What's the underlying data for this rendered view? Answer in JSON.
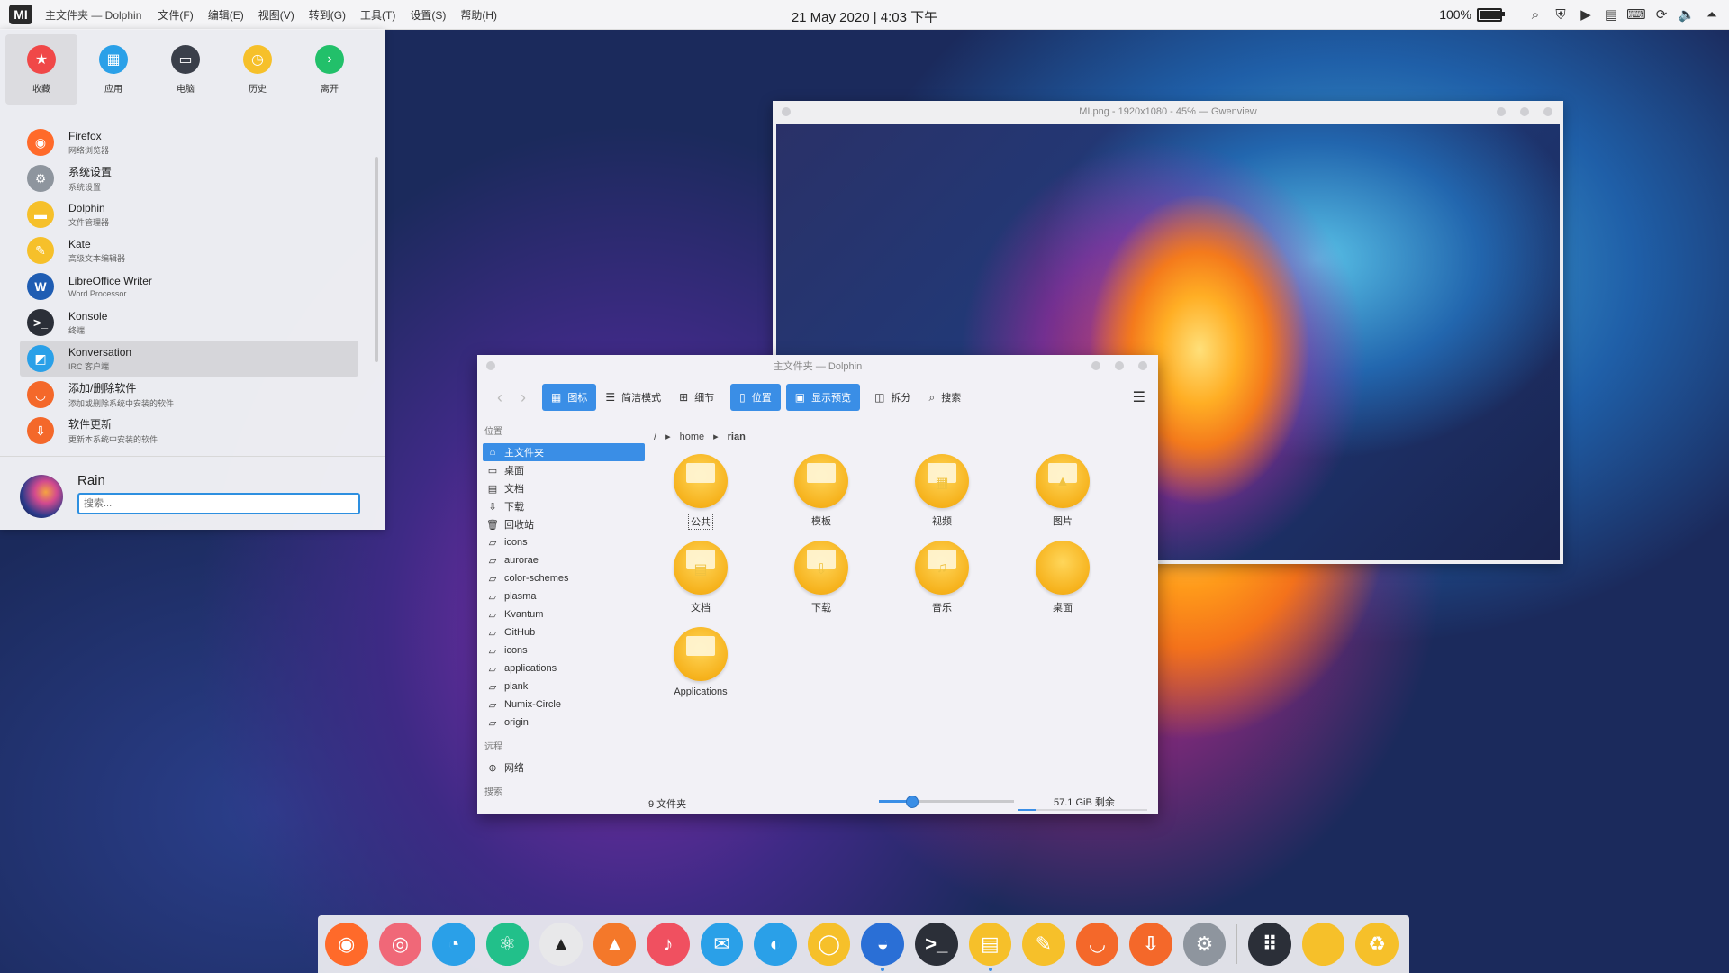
{
  "topbar": {
    "logo": "MI",
    "app_title": "主文件夹 — Dolphin",
    "menus": [
      "文件(F)",
      "编辑(E)",
      "视图(V)",
      "转到(G)",
      "工具(T)",
      "设置(S)",
      "帮助(H)"
    ],
    "clock": "21 May 2020 | 4:03 下午",
    "battery_percent": "100%",
    "battery_level": 1.0,
    "tray_icons": [
      "search-icon",
      "shield-icon",
      "play-icon",
      "clipboard-icon",
      "keyboard-icon",
      "sync-icon",
      "volume-icon",
      "up-arrow-icon"
    ]
  },
  "launcher": {
    "tabs": [
      {
        "label": "收藏",
        "icon": "star-icon",
        "color": "#f04848",
        "active": true
      },
      {
        "label": "应用",
        "icon": "grid-icon",
        "color": "#2aa0e8",
        "active": false
      },
      {
        "label": "电脑",
        "icon": "monitor-icon",
        "color": "#3a3f4a",
        "active": false
      },
      {
        "label": "历史",
        "icon": "clock-icon",
        "color": "#f6c02a",
        "active": false
      },
      {
        "label": "离开",
        "icon": "arrow-right-icon",
        "color": "#22c06a",
        "active": false
      }
    ],
    "apps": [
      {
        "name": "Firefox",
        "desc": "网络浏览器",
        "icon": "firefox-icon",
        "color": "#ff6a2a"
      },
      {
        "name": "系统设置",
        "desc": "系统设置",
        "icon": "settings-icon",
        "color": "#8e959e"
      },
      {
        "name": "Dolphin",
        "desc": "文件管理器",
        "icon": "folder-icon",
        "color": "#f6c02a"
      },
      {
        "name": "Kate",
        "desc": "高级文本编辑器",
        "icon": "pen-icon",
        "color": "#f6c02a"
      },
      {
        "name": "LibreOffice Writer",
        "desc": "Word Processor",
        "icon": "writer-icon",
        "color": "#1f5db3"
      },
      {
        "name": "Konsole",
        "desc": "终端",
        "icon": "terminal-icon",
        "color": "#2b2f38"
      },
      {
        "name": "Konversation",
        "desc": "IRC 客户端",
        "icon": "chat-icon",
        "color": "#2aa0e8"
      },
      {
        "name": "添加/删除软件",
        "desc": "添加或删除系统中安装的软件",
        "icon": "shop-icon",
        "color": "#f4682a"
      },
      {
        "name": "软件更新",
        "desc": "更新本系统中安装的软件",
        "icon": "update-icon",
        "color": "#f4682a"
      }
    ],
    "hover_index": 6,
    "user_name": "Rain",
    "search_placeholder": "搜索..."
  },
  "gwenview": {
    "title": "MI.png - 1920x1080 - 45% — Gwenview"
  },
  "dolphin": {
    "title": "主文件夹 — Dolphin",
    "toolbar": {
      "icons_label": "图标",
      "compact_label": "简洁模式",
      "details_label": "细节",
      "places_label": "位置",
      "preview_label": "显示预览",
      "split_label": "拆分",
      "search_label": "搜索"
    },
    "places_header": "位置",
    "places": [
      {
        "label": "主文件夹",
        "glyph": "⌂",
        "selected": true
      },
      {
        "label": "桌面",
        "glyph": "▭"
      },
      {
        "label": "文档",
        "glyph": "▤"
      },
      {
        "label": "下载",
        "glyph": "⇩"
      },
      {
        "label": "回收站",
        "glyph": "🗑"
      },
      {
        "label": "icons",
        "glyph": "▱"
      },
      {
        "label": "aurorae",
        "glyph": "▱"
      },
      {
        "label": "color-schemes",
        "glyph": "▱"
      },
      {
        "label": "plasma",
        "glyph": "▱"
      },
      {
        "label": "Kvantum",
        "glyph": "▱"
      },
      {
        "label": "GitHub",
        "glyph": "▱"
      },
      {
        "label": "icons",
        "glyph": "▱"
      },
      {
        "label": "applications",
        "glyph": "▱"
      },
      {
        "label": "plank",
        "glyph": "▱"
      },
      {
        "label": "Numix-Circle",
        "glyph": "▱"
      },
      {
        "label": "origin",
        "glyph": "▱"
      }
    ],
    "remote_header": "远程",
    "remote": [
      {
        "label": "网络",
        "glyph": "⊕"
      }
    ],
    "search_header": "搜索",
    "breadcrumb": {
      "root": "/",
      "home": "home",
      "user": "rian"
    },
    "files": [
      {
        "name": "公共",
        "glyph": "",
        "selected": true
      },
      {
        "name": "模板",
        "glyph": ""
      },
      {
        "name": "视频",
        "glyph": "▦"
      },
      {
        "name": "图片",
        "glyph": "▲"
      },
      {
        "name": "文档",
        "glyph": "▤"
      },
      {
        "name": "下载",
        "glyph": "⇩"
      },
      {
        "name": "音乐",
        "glyph": "♫"
      },
      {
        "name": "桌面",
        "glyph": "",
        "plain": true
      },
      {
        "name": "Applications",
        "glyph": ""
      }
    ],
    "status_count": "9 文件夹",
    "zoom_level": 0.24,
    "free_space": "57.1 GiB 剩余",
    "free_fraction": 0.14
  },
  "dock": {
    "apps": [
      {
        "name": "firefox-icon",
        "color": "#ff6a2a",
        "glyph": "◉"
      },
      {
        "name": "browser-icon",
        "color": "#f06878",
        "glyph": "◎"
      },
      {
        "name": "github-icon",
        "color": "#2aa0e8",
        "glyph": "◔"
      },
      {
        "name": "atom-icon",
        "color": "#22c08a",
        "glyph": "⚛"
      },
      {
        "name": "inkscape-icon",
        "color": "#e8e8ea",
        "glyph": "▲"
      },
      {
        "name": "vlc-icon",
        "color": "#f4782a",
        "glyph": "▲"
      },
      {
        "name": "music-icon",
        "color": "#f05060",
        "glyph": "♪"
      },
      {
        "name": "mail-icon",
        "color": "#2aa0e8",
        "glyph": "✉"
      },
      {
        "name": "qq-icon",
        "color": "#2aa0e8",
        "glyph": "◐"
      },
      {
        "name": "search-icon",
        "color": "#f6c02a",
        "glyph": "◯"
      },
      {
        "name": "image-viewer-icon",
        "color": "#2a6fd6",
        "glyph": "◒",
        "running": true
      },
      {
        "name": "terminal-icon",
        "color": "#2b2f38",
        "glyph": ">_"
      },
      {
        "name": "files-icon",
        "color": "#f6c02a",
        "glyph": "▤",
        "running": true
      },
      {
        "name": "editor-icon",
        "color": "#f6c02a",
        "glyph": "✎"
      },
      {
        "name": "shop-icon",
        "color": "#f4682a",
        "glyph": "◡"
      },
      {
        "name": "update-icon",
        "color": "#f4682a",
        "glyph": "⇩"
      },
      {
        "name": "settings-icon",
        "color": "#8e959e",
        "glyph": "⚙"
      }
    ],
    "extras": [
      {
        "name": "app-grid-icon",
        "color": "#2b2f38",
        "glyph": "⠿"
      },
      {
        "name": "home-folder-icon",
        "color": "#f6c02a",
        "glyph": ""
      },
      {
        "name": "trash-icon",
        "color": "#f6c02a",
        "glyph": "♻"
      }
    ]
  }
}
